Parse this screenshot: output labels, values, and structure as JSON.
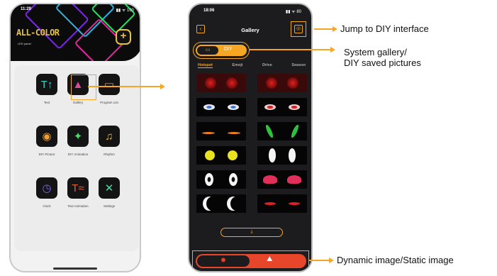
{
  "colors": {
    "accent": "#f5a623",
    "red": "#e8462a",
    "dark": "#1c1c1e"
  },
  "home": {
    "status_time": "11:29",
    "status_icons": "▮▮ ᯤ 100",
    "logo": "ALL-COLOR",
    "logo_subtitle": "LED panel",
    "apps": [
      {
        "label": "Text",
        "icon": "text-icon"
      },
      {
        "label": "Gallery",
        "icon": "gallery-icon"
      },
      {
        "label": "Program List",
        "icon": "program-list-icon"
      },
      {
        "label": "DIY Picture",
        "icon": "diy-picture-icon"
      },
      {
        "label": "DIY Animation",
        "icon": "diy-animation-icon"
      },
      {
        "label": "Rhythm",
        "icon": "rhythm-icon"
      },
      {
        "label": "Clock",
        "icon": "clock-icon"
      },
      {
        "label": "Text Animation",
        "icon": "text-animation-icon"
      },
      {
        "label": "Settings",
        "icon": "settings-icon"
      }
    ]
  },
  "gallery": {
    "status_time": "18:06",
    "status_icons": "▮▮ ᯤ 80",
    "title": "Gallery",
    "toggle": {
      "right_label": "DIY"
    },
    "tabs": [
      "Hotspot",
      "Emoji",
      "Drive",
      "Season"
    ],
    "active_tab": 0
  },
  "callouts": {
    "diy_jump": "Jump to DIY interface",
    "system_gallery_line1": "System gallery/",
    "system_gallery_line2": "DIY saved pictures",
    "dynamic_static": "Dynamic image/Static image"
  }
}
